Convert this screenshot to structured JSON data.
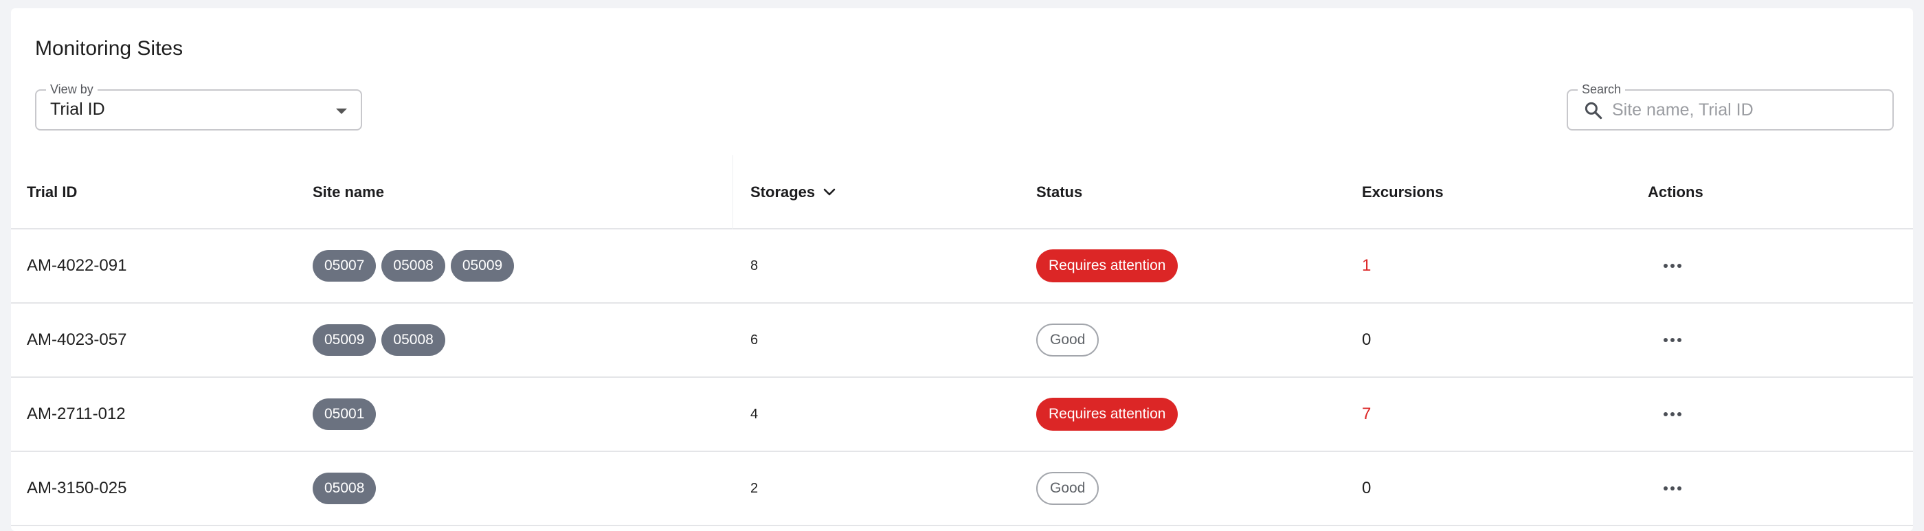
{
  "page": {
    "title": "Monitoring Sites"
  },
  "filters": {
    "view_by": {
      "label": "View by",
      "value": "Trial ID"
    },
    "search": {
      "label": "Search",
      "placeholder": "Site name, Trial ID",
      "value": ""
    }
  },
  "table": {
    "columns": {
      "trial_id": "Trial ID",
      "site_name": "Site name",
      "storages": "Storages",
      "status": "Status",
      "excursions": "Excursions",
      "actions": "Actions"
    },
    "sort": {
      "column": "Storages",
      "direction": "descending"
    },
    "rows": [
      {
        "trial_id": "AM-4022-091",
        "sites": [
          "05007",
          "05008",
          "05009"
        ],
        "storages": "8",
        "status": "Requires attention",
        "status_type": "attention",
        "excursions": "1",
        "excursion_alert": true
      },
      {
        "trial_id": "AM-4023-057",
        "sites": [
          "05009",
          "05008"
        ],
        "storages": "6",
        "status": "Good",
        "status_type": "good",
        "excursions": "0",
        "excursion_alert": false
      },
      {
        "trial_id": "AM-2711-012",
        "sites": [
          "05001"
        ],
        "storages": "4",
        "status": "Requires attention",
        "status_type": "attention",
        "excursions": "7",
        "excursion_alert": true
      },
      {
        "trial_id": "AM-3150-025",
        "sites": [
          "05008"
        ],
        "storages": "2",
        "status": "Good",
        "status_type": "good",
        "excursions": "0",
        "excursion_alert": false
      }
    ]
  },
  "icons": {
    "search": "search-icon",
    "dropdown": "chevron-down-icon",
    "sort": "chevron-down-icon",
    "row_actions": "more-horizontal-icon"
  },
  "colors": {
    "chip": "#6b7280",
    "attention": "#dc2626",
    "good_border": "#a3a6ac"
  }
}
